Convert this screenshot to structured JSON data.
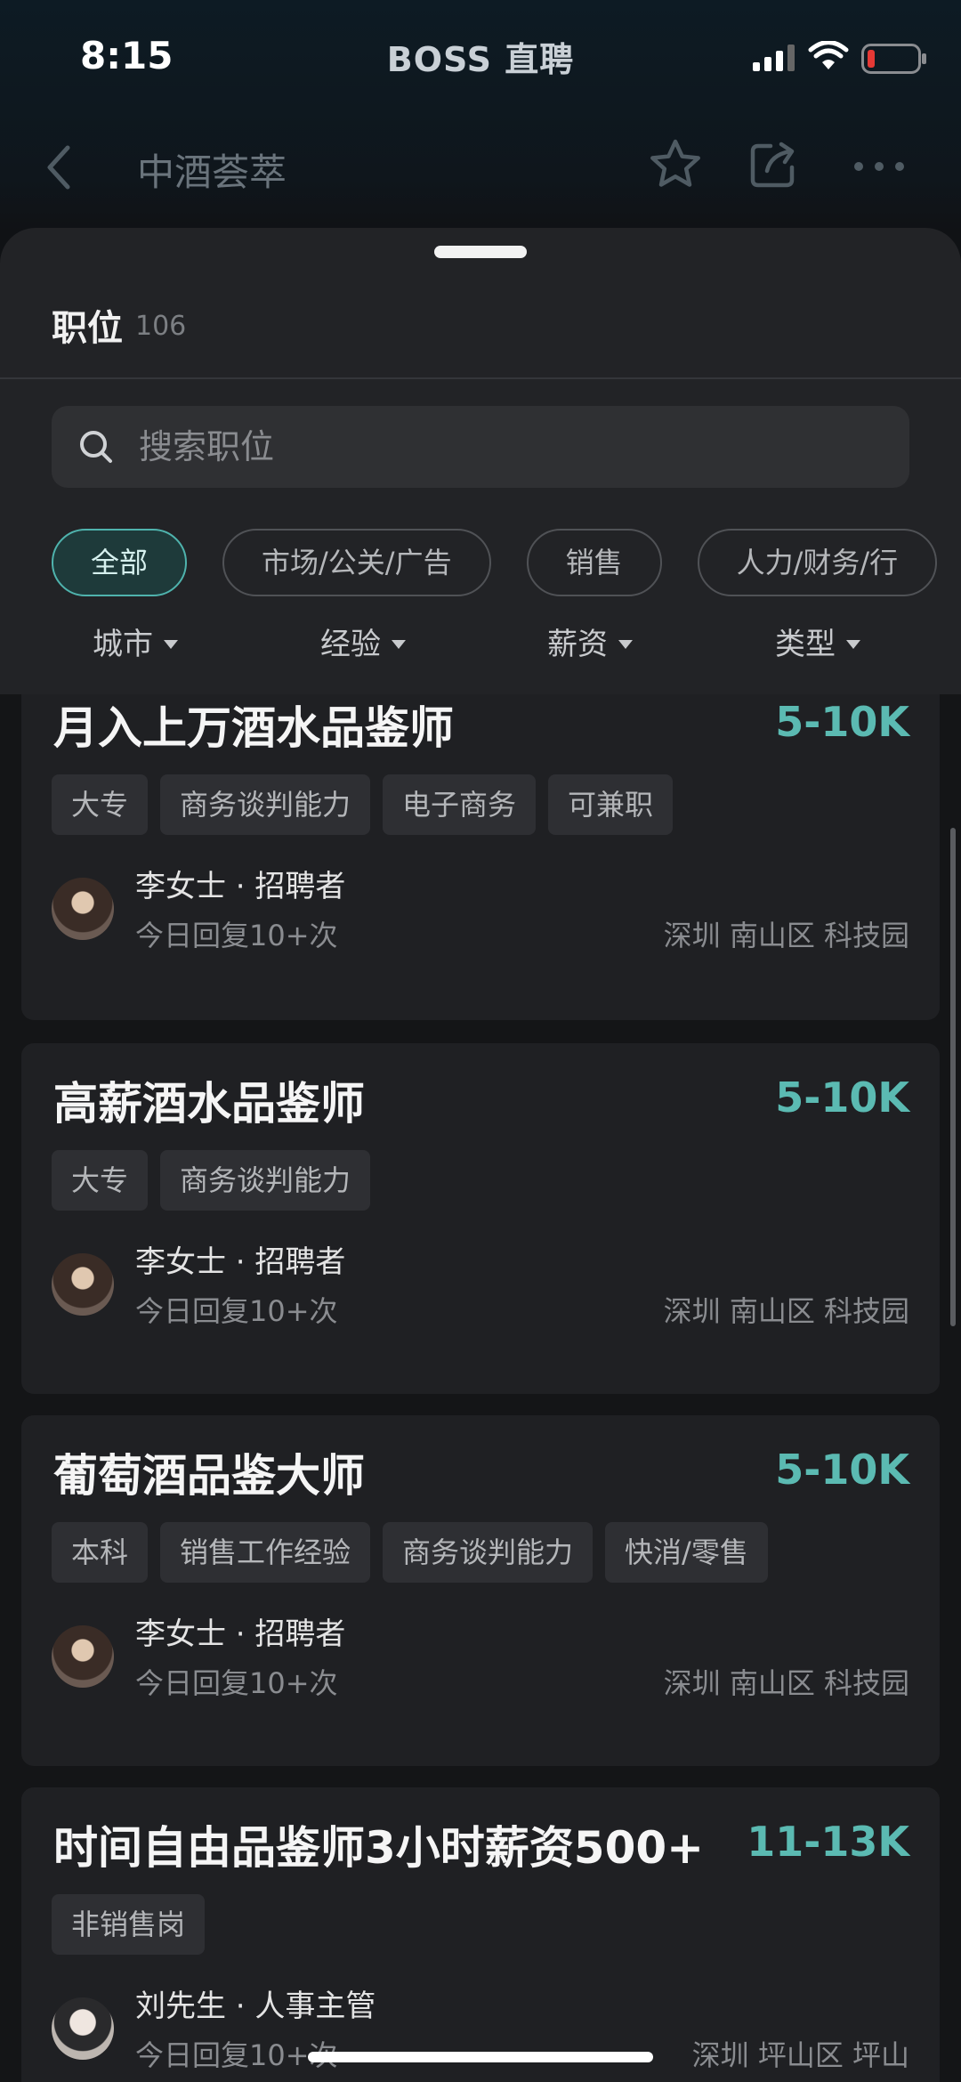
{
  "status_bar": {
    "time": "8:15",
    "app_name": "BOSS 直聘",
    "battery_color": "#e53935"
  },
  "header": {
    "company": "中酒荟萃",
    "back_icon": "chevron-left-icon",
    "icons": [
      "star-icon",
      "share-icon",
      "more-icon"
    ]
  },
  "sheet": {
    "label": "职位",
    "count": "106",
    "search_placeholder": "搜索职位",
    "chips": [
      {
        "label": "全部",
        "active": true
      },
      {
        "label": "市场/公关/广告",
        "active": false
      },
      {
        "label": "销售",
        "active": false
      },
      {
        "label": "人力/财务/行",
        "active": false
      }
    ],
    "filters": [
      "城市",
      "经验",
      "薪资",
      "类型"
    ]
  },
  "jobs": [
    {
      "title": "月入上万酒水品鉴师",
      "salary": "5-10K",
      "tags": [
        "大专",
        "商务谈判能力",
        "电子商务",
        "可兼职"
      ],
      "recruiter": "李女士 · 招聘者",
      "reply": "今日回复10+次",
      "location": "深圳 南山区 科技园"
    },
    {
      "title": "高薪酒水品鉴师",
      "salary": "5-10K",
      "tags": [
        "大专",
        "商务谈判能力"
      ],
      "recruiter": "李女士 · 招聘者",
      "reply": "今日回复10+次",
      "location": "深圳 南山区 科技园"
    },
    {
      "title": "葡萄酒品鉴大师",
      "salary": "5-10K",
      "tags": [
        "本科",
        "销售工作经验",
        "商务谈判能力",
        "快消/零售"
      ],
      "recruiter": "李女士 · 招聘者",
      "reply": "今日回复10+次",
      "location": "深圳 南山区 科技园"
    },
    {
      "title": "时间自由品鉴师3小时薪资500+",
      "salary": "11-13K",
      "tags": [
        "非销售岗"
      ],
      "recruiter": "刘先生 · 人事主管",
      "reply": "今日回复10+次",
      "location": "深圳 坪山区 坪山"
    }
  ],
  "colors": {
    "accent": "#5bbab2",
    "background": "#141517",
    "card": "#1f2023"
  }
}
